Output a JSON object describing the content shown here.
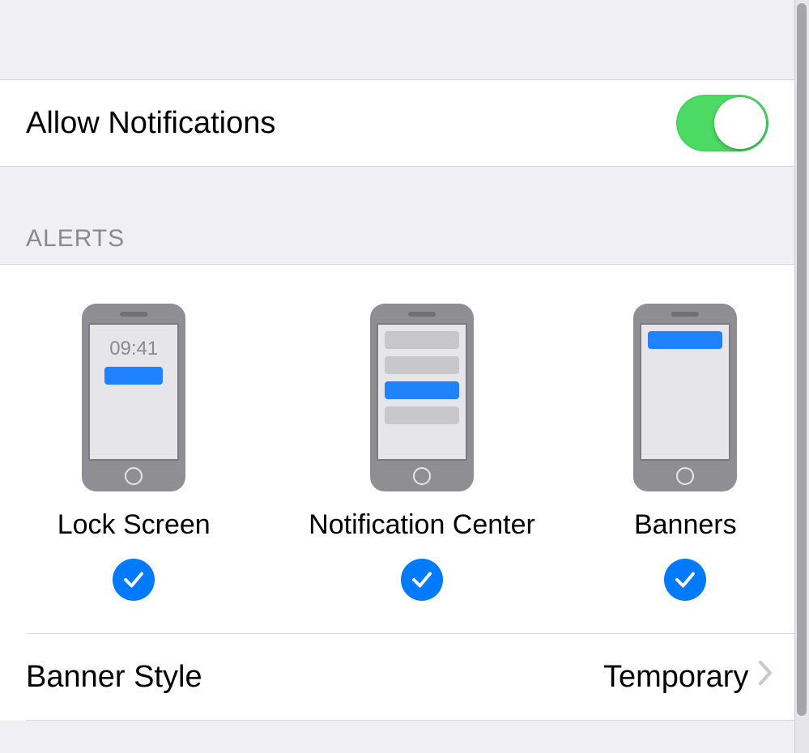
{
  "rows": {
    "allow": {
      "label": "Allow Notifications",
      "enabled": true
    },
    "bannerStyle": {
      "label": "Banner Style",
      "value": "Temporary"
    }
  },
  "alerts": {
    "header": "ALERTS",
    "clock": "09:41",
    "options": [
      {
        "kind": "lockScreen",
        "label": "Lock Screen",
        "checked": true
      },
      {
        "kind": "notificationCenter",
        "label": "Notification Center",
        "checked": true
      },
      {
        "kind": "banners",
        "label": "Banners",
        "checked": true
      }
    ]
  },
  "colors": {
    "accent": "#007aff",
    "switchOn": "#4cd964"
  }
}
